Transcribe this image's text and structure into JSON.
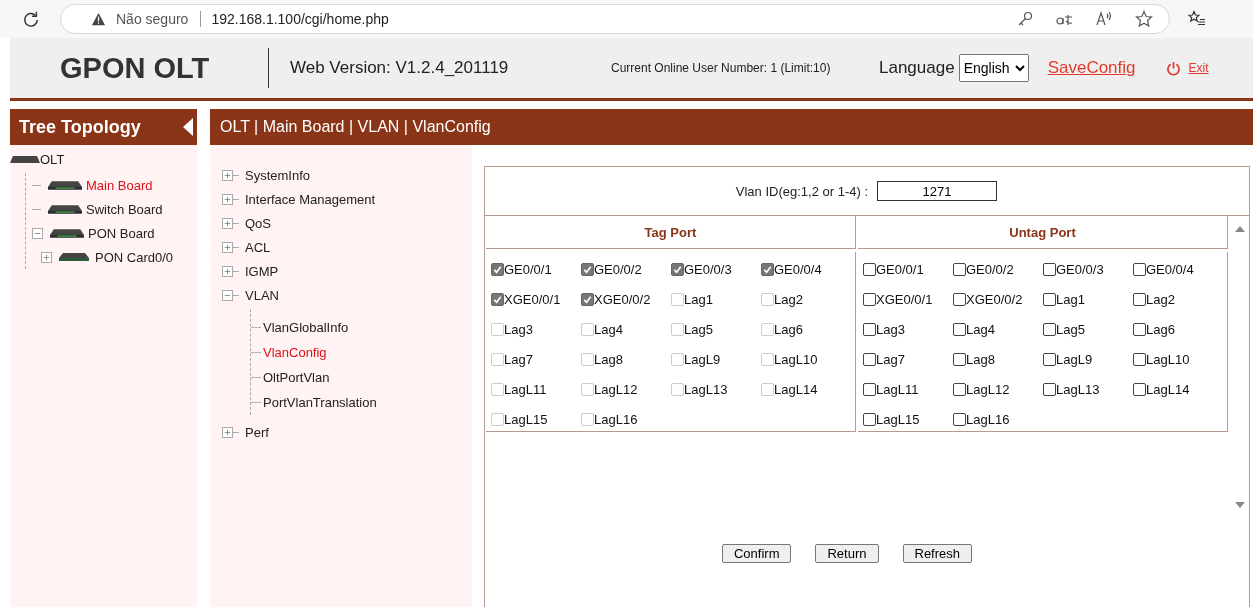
{
  "browser": {
    "security": "Não seguro",
    "url": "192.168.1.100/cgi/home.php"
  },
  "header": {
    "logo": "GPON OLT",
    "version": "Web Version: V1.2.4_201119",
    "online_users": "Current Online User Number: 1 (Limit:10)",
    "language_label": "Language",
    "language_value": "English",
    "save": "SaveConfig",
    "exit": "Exit"
  },
  "tree": {
    "title": "Tree Topology",
    "nodes": [
      {
        "label": "OLT",
        "selected": false,
        "children": [
          {
            "label": "Main Board",
            "selected": true
          },
          {
            "label": "Switch Board",
            "selected": false
          },
          {
            "label": "PON Board",
            "selected": false,
            "expanded": true,
            "children": [
              {
                "label": "PON Card0/0",
                "selected": false,
                "expanded": false
              }
            ]
          }
        ]
      }
    ]
  },
  "breadcrumb": "OLT | Main Board | VLAN | VlanConfig",
  "menu": [
    {
      "label": "SystemInfo",
      "expanded": false
    },
    {
      "label": "Interface Management",
      "expanded": false
    },
    {
      "label": "QoS",
      "expanded": false
    },
    {
      "label": "ACL",
      "expanded": false
    },
    {
      "label": "IGMP",
      "expanded": false
    },
    {
      "label": "VLAN",
      "expanded": true,
      "children": [
        {
          "label": "VlanGlobalInfo",
          "selected": false
        },
        {
          "label": "VlanConfig",
          "selected": true
        },
        {
          "label": "OltPortVlan",
          "selected": false
        },
        {
          "label": "PortVlanTranslation",
          "selected": false
        }
      ]
    },
    {
      "label": "Perf",
      "expanded": false
    }
  ],
  "form": {
    "vlan_label": "Vlan ID(eg:1,2 or 1-4) :",
    "vlan_value": "1271"
  },
  "port_panels": [
    {
      "title": "Tag Port",
      "disabled": true,
      "ports": [
        {
          "label": "GE0/0/1",
          "checked": true
        },
        {
          "label": "GE0/0/2",
          "checked": true
        },
        {
          "label": "GE0/0/3",
          "checked": true
        },
        {
          "label": "GE0/0/4",
          "checked": true
        },
        {
          "label": "XGE0/0/1",
          "checked": true
        },
        {
          "label": "XGE0/0/2",
          "checked": true
        },
        {
          "label": "Lag1",
          "checked": false
        },
        {
          "label": "Lag2",
          "checked": false
        },
        {
          "label": "Lag3",
          "checked": false
        },
        {
          "label": "Lag4",
          "checked": false
        },
        {
          "label": "Lag5",
          "checked": false
        },
        {
          "label": "Lag6",
          "checked": false
        },
        {
          "label": "Lag7",
          "checked": false
        },
        {
          "label": "Lag8",
          "checked": false
        },
        {
          "label": "LagL9",
          "checked": false
        },
        {
          "label": "LagL10",
          "checked": false
        },
        {
          "label": "LagL11",
          "checked": false
        },
        {
          "label": "LagL12",
          "checked": false
        },
        {
          "label": "LagL13",
          "checked": false
        },
        {
          "label": "LagL14",
          "checked": false
        },
        {
          "label": "LagL15",
          "checked": false
        },
        {
          "label": "LagL16",
          "checked": false
        }
      ]
    },
    {
      "title": "Untag Port",
      "disabled": false,
      "ports": [
        {
          "label": "GE0/0/1",
          "checked": false
        },
        {
          "label": "GE0/0/2",
          "checked": false
        },
        {
          "label": "GE0/0/3",
          "checked": false
        },
        {
          "label": "GE0/0/4",
          "checked": false
        },
        {
          "label": "XGE0/0/1",
          "checked": false
        },
        {
          "label": "XGE0/0/2",
          "checked": false
        },
        {
          "label": "Lag1",
          "checked": false
        },
        {
          "label": "Lag2",
          "checked": false
        },
        {
          "label": "Lag3",
          "checked": false
        },
        {
          "label": "Lag4",
          "checked": false
        },
        {
          "label": "Lag5",
          "checked": false
        },
        {
          "label": "Lag6",
          "checked": false
        },
        {
          "label": "Lag7",
          "checked": false
        },
        {
          "label": "Lag8",
          "checked": false
        },
        {
          "label": "LagL9",
          "checked": false
        },
        {
          "label": "LagL10",
          "checked": false
        },
        {
          "label": "LagL11",
          "checked": false
        },
        {
          "label": "LagL12",
          "checked": false
        },
        {
          "label": "LagL13",
          "checked": false
        },
        {
          "label": "LagL14",
          "checked": false
        },
        {
          "label": "LagL15",
          "checked": false
        },
        {
          "label": "LagL16",
          "checked": false
        }
      ]
    }
  ],
  "buttons": [
    "Confirm",
    "Return",
    "Refresh"
  ]
}
